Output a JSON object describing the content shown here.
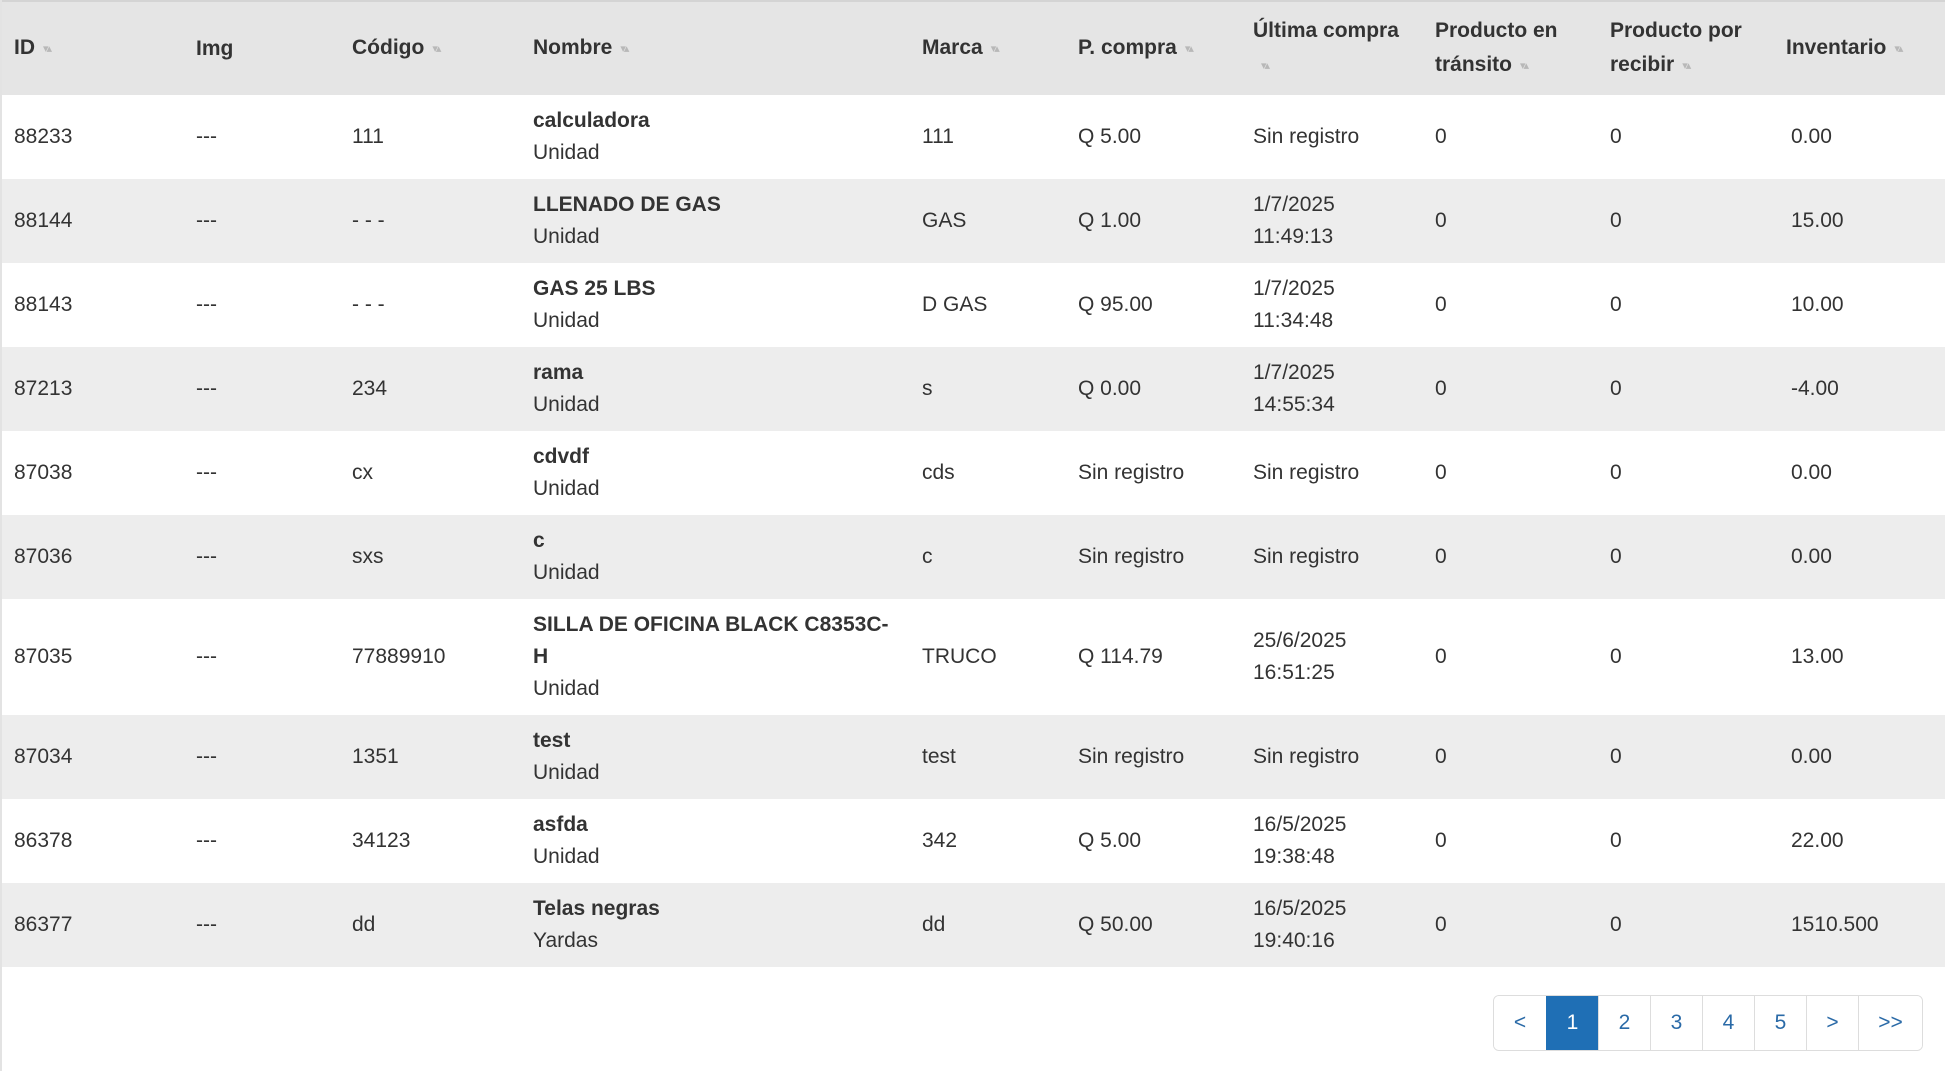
{
  "colors": {
    "accent": "#1f6fb5",
    "header_bg": "#e5e5e5",
    "row_alt": "#ededed"
  },
  "columns": [
    {
      "label": "ID",
      "sortable": true
    },
    {
      "label": "Img",
      "sortable": false
    },
    {
      "label": "Código",
      "sortable": true
    },
    {
      "label": "Nombre",
      "sortable": true
    },
    {
      "label": "Marca",
      "sortable": true
    },
    {
      "label": "P. compra",
      "sortable": true
    },
    {
      "label": "Última compra",
      "sortable": true
    },
    {
      "label": "Producto en tránsito",
      "sortable": true
    },
    {
      "label": "Producto por recibir",
      "sortable": true
    },
    {
      "label": "Inventario",
      "sortable": true
    }
  ],
  "rows": [
    {
      "id": "88233",
      "img": "---",
      "codigo": "111",
      "nombre": "calculadora",
      "unidad": "Unidad",
      "marca": "111",
      "p_compra": "Q 5.00",
      "ultima_compra": "Sin registro",
      "transito": "0",
      "por_recibir": "0",
      "inventario": "0.00"
    },
    {
      "id": "88144",
      "img": "---",
      "codigo": "- - -",
      "nombre": "LLENADO DE GAS",
      "unidad": "Unidad",
      "marca": "GAS",
      "p_compra": "Q 1.00",
      "ultima_compra": "1/7/2025 11:49:13",
      "transito": "0",
      "por_recibir": "0",
      "inventario": "15.00"
    },
    {
      "id": "88143",
      "img": "---",
      "codigo": "- - -",
      "nombre": "GAS 25 LBS",
      "unidad": "Unidad",
      "marca": "D GAS",
      "p_compra": "Q 95.00",
      "ultima_compra": "1/7/2025 11:34:48",
      "transito": "0",
      "por_recibir": "0",
      "inventario": "10.00"
    },
    {
      "id": "87213",
      "img": "---",
      "codigo": "234",
      "nombre": "rama",
      "unidad": "Unidad",
      "marca": "s",
      "p_compra": "Q 0.00",
      "ultima_compra": "1/7/2025 14:55:34",
      "transito": "0",
      "por_recibir": "0",
      "inventario": "-4.00"
    },
    {
      "id": "87038",
      "img": "---",
      "codigo": "cx",
      "nombre": "cdvdf",
      "unidad": "Unidad",
      "marca": "cds",
      "p_compra": "Sin registro",
      "ultima_compra": "Sin registro",
      "transito": "0",
      "por_recibir": "0",
      "inventario": "0.00"
    },
    {
      "id": "87036",
      "img": "---",
      "codigo": "sxs",
      "nombre": "c",
      "unidad": "Unidad",
      "marca": "c",
      "p_compra": "Sin registro",
      "ultima_compra": "Sin registro",
      "transito": "0",
      "por_recibir": "0",
      "inventario": "0.00"
    },
    {
      "id": "87035",
      "img": "---",
      "codigo": "77889910",
      "nombre": "SILLA DE OFICINA BLACK C8353C-H",
      "unidad": "Unidad",
      "marca": "TRUCO",
      "p_compra": "Q 114.79",
      "ultima_compra": "25/6/2025 16:51:25",
      "transito": "0",
      "por_recibir": "0",
      "inventario": "13.00"
    },
    {
      "id": "87034",
      "img": "---",
      "codigo": "1351",
      "nombre": "test",
      "unidad": "Unidad",
      "marca": "test",
      "p_compra": "Sin registro",
      "ultima_compra": "Sin registro",
      "transito": "0",
      "por_recibir": "0",
      "inventario": "0.00"
    },
    {
      "id": "86378",
      "img": "---",
      "codigo": "34123",
      "nombre": "asfda",
      "unidad": "Unidad",
      "marca": "342",
      "p_compra": "Q 5.00",
      "ultima_compra": "16/5/2025 19:38:48",
      "transito": "0",
      "por_recibir": "0",
      "inventario": "22.00"
    },
    {
      "id": "86377",
      "img": "---",
      "codigo": "dd",
      "nombre": "Telas negras",
      "unidad": "Yardas",
      "marca": "dd",
      "p_compra": "Q 50.00",
      "ultima_compra": "16/5/2025 19:40:16",
      "transito": "0",
      "por_recibir": "0",
      "inventario": "1510.500"
    }
  ],
  "pagination": {
    "prev": "<",
    "pages": [
      "1",
      "2",
      "3",
      "4",
      "5"
    ],
    "current_page": "1",
    "next": ">",
    "last": ">>"
  }
}
